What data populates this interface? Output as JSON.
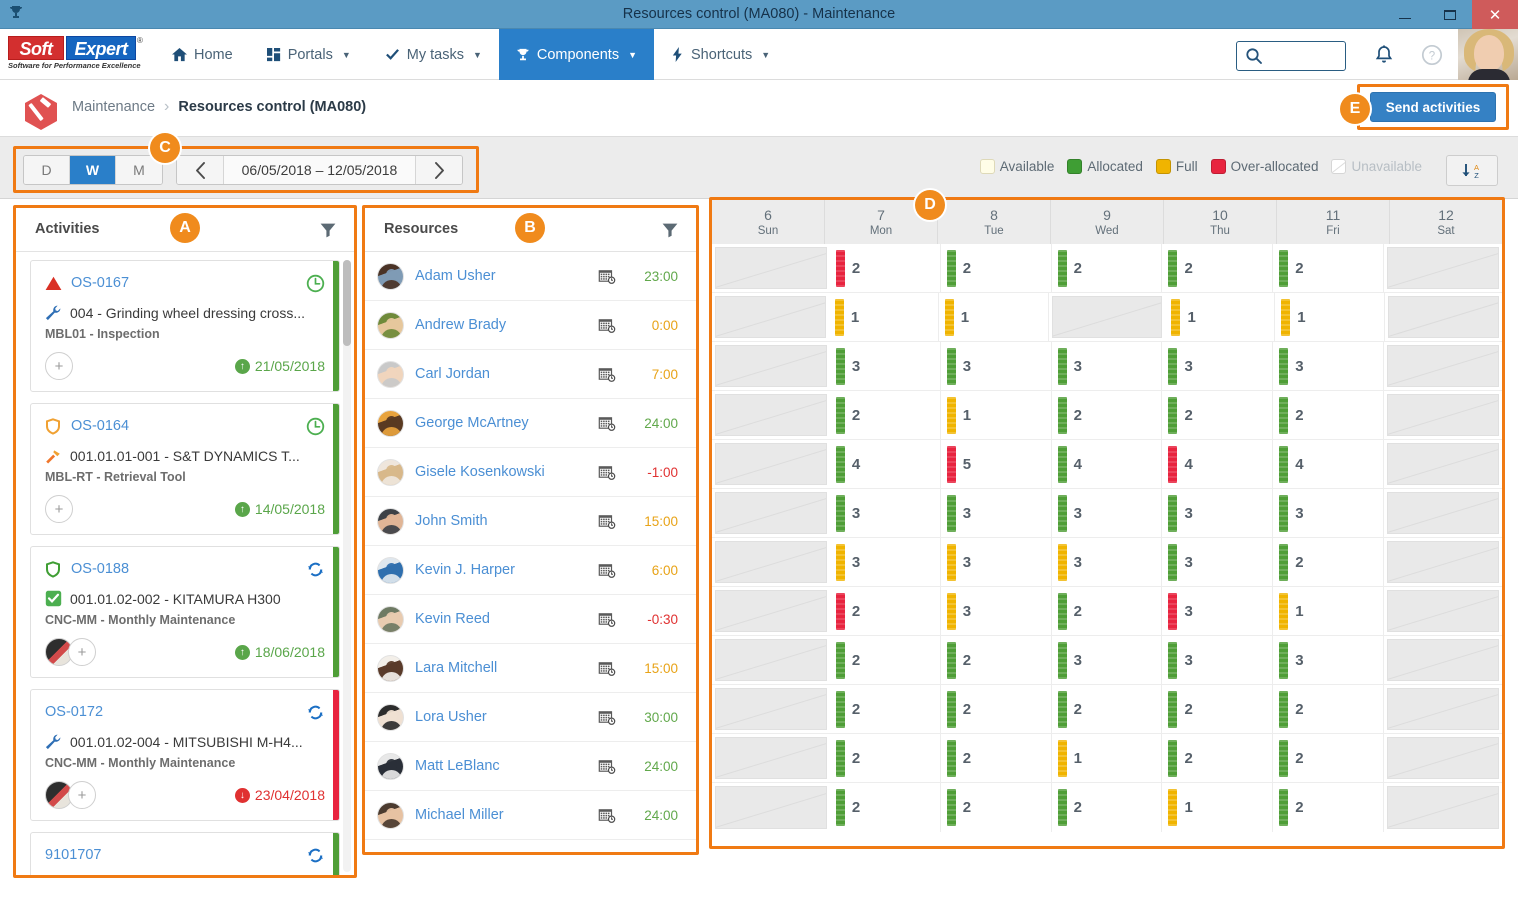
{
  "window": {
    "title": "Resources control (MA080) - Maintenance",
    "app_icon": "trophy-icon",
    "minimize": "–",
    "maximize": "☐",
    "close": "✕"
  },
  "topnav": {
    "logo": {
      "part1": "Soft",
      "part2": "Expert",
      "registered": "®",
      "tagline": "Software for Performance Excellence"
    },
    "items": [
      {
        "label": "Home",
        "icon": "home-icon",
        "caret": false,
        "active": false
      },
      {
        "label": "Portals",
        "icon": "grid-icon",
        "caret": true,
        "active": false
      },
      {
        "label": "My tasks",
        "icon": "check-icon",
        "caret": true,
        "active": false
      },
      {
        "label": "Components",
        "icon": "trophy-icon",
        "caret": true,
        "active": true
      },
      {
        "label": "Shortcuts",
        "icon": "bolt-icon",
        "caret": true,
        "active": false
      }
    ],
    "search": {
      "placeholder": "",
      "value": "",
      "icon": "search-icon"
    },
    "notifications_icon": "bell-icon",
    "help_icon": "question-circle-icon",
    "avatar": "user-avatar"
  },
  "breadcrumb": {
    "module_icon": "maintenance-hammer-icon",
    "parent": "Maintenance",
    "separator": "›",
    "current": "Resources control (MA080)"
  },
  "actions": {
    "send_activities": "Send activities"
  },
  "callouts": {
    "a": "A",
    "b": "B",
    "c": "C",
    "d": "D",
    "e": "E"
  },
  "toolbar": {
    "view_modes": [
      {
        "label": "D",
        "active": false
      },
      {
        "label": "W",
        "active": true
      },
      {
        "label": "M",
        "active": false
      }
    ],
    "prev_icon": "chevron-left-icon",
    "next_icon": "chevron-right-icon",
    "date_range": "06/05/2018 – 12/05/2018",
    "sort_icon": "sort-az-descending-icon",
    "legend": [
      {
        "label": "Available",
        "color": "#fffde7",
        "dim": false
      },
      {
        "label": "Allocated",
        "color": "#3f9e34",
        "dim": false
      },
      {
        "label": "Full",
        "color": "#f0b400",
        "dim": false
      },
      {
        "label": "Over-allocated",
        "color": "#e8243f",
        "dim": false
      },
      {
        "label": "Unavailable",
        "color": "#ffffff",
        "dim": true
      }
    ]
  },
  "activities_panel": {
    "title": "Activities",
    "filter_icon": "funnel-icon",
    "cards": [
      {
        "code": "OS-0167",
        "status_icon": "triangle-warning-icon",
        "status_color": "#d93025",
        "right_icon": "clock-icon",
        "right_icon_color": "#4caf50",
        "asset_icon": "wrench-icon",
        "asset": "004 - Grinding wheel dressing cross...",
        "task": "MBL01 - Inspection",
        "date": "21/05/2018",
        "date_state": "ok",
        "date_arrow": "↑",
        "stripe": "#4f9e37",
        "has_avatar": false,
        "add_label": "+"
      },
      {
        "code": "OS-0164",
        "status_icon": "shield-icon",
        "status_color": "#f0a132",
        "right_icon": "clock-icon",
        "right_icon_color": "#4caf50",
        "asset_icon": "hammer-icon",
        "asset": "001.01.01-001 - S&T DYNAMICS T...",
        "task": "MBL-RT - Retrieval Tool",
        "date": "14/05/2018",
        "date_state": "ok",
        "date_arrow": "↑",
        "stripe": "#4f9e37",
        "has_avatar": false,
        "add_label": "+"
      },
      {
        "code": "OS-0188",
        "status_icon": "shield-icon",
        "status_color": "#3f9e34",
        "right_icon": "sync-icon",
        "right_icon_color": "#1b6fc4",
        "asset_icon": "check-square-icon",
        "asset": "001.01.02-002 - KITAMURA H300",
        "task": "CNC-MM - Monthly Maintenance",
        "date": "18/06/2018",
        "date_state": "ok",
        "date_arrow": "↑",
        "stripe": "#4f9e37",
        "has_avatar": true,
        "add_label": "+"
      },
      {
        "code": "OS-0172",
        "status_icon": "none",
        "status_color": "",
        "right_icon": "sync-icon",
        "right_icon_color": "#1b6fc4",
        "asset_icon": "wrench-icon",
        "asset": "001.01.02-004 - MITSUBISHI M-H4...",
        "task": "CNC-MM - Monthly Maintenance",
        "date": "23/04/2018",
        "date_state": "late",
        "date_arrow": "↓",
        "stripe": "#e8243f",
        "has_avatar": true,
        "add_label": "+"
      },
      {
        "code": "9101707",
        "status_icon": "none",
        "status_color": "",
        "right_icon": "sync-icon",
        "right_icon_color": "#1b6fc4",
        "asset_icon": "none",
        "asset": "",
        "task": "",
        "date": "",
        "date_state": "ok",
        "date_arrow": "",
        "stripe": "#4f9e37",
        "has_avatar": false,
        "add_label": "+"
      }
    ]
  },
  "resources_panel": {
    "title": "Resources",
    "filter_icon": "funnel-icon",
    "calendar_icon": "calendar-clock-icon",
    "rows": [
      {
        "name": "Adam Usher",
        "hours": "23:00",
        "state": "green",
        "avatar_colors": [
          "#4a3326",
          "#7f9bb5"
        ]
      },
      {
        "name": "Andrew Brady",
        "hours": "0:00",
        "state": "amber",
        "avatar_colors": [
          "#6f8a3a",
          "#e6c79c"
        ]
      },
      {
        "name": "Carl Jordan",
        "hours": "7:00",
        "state": "amber",
        "avatar_colors": [
          "#c9c9c9",
          "#f0d5bd"
        ]
      },
      {
        "name": "George McArtney",
        "hours": "24:00",
        "state": "green",
        "avatar_colors": [
          "#e8a33d",
          "#5a3a22"
        ]
      },
      {
        "name": "Gisele Kosenkowski",
        "hours": "-1:00",
        "state": "red",
        "avatar_colors": [
          "#efe6dc",
          "#d8b88a"
        ]
      },
      {
        "name": "John Smith",
        "hours": "15:00",
        "state": "amber",
        "avatar_colors": [
          "#3d4146",
          "#e0b596"
        ]
      },
      {
        "name": "Kevin J. Harper",
        "hours": "6:00",
        "state": "amber",
        "avatar_colors": [
          "#dfe7ee",
          "#2f6fae"
        ]
      },
      {
        "name": "Kevin Reed",
        "hours": "-0:30",
        "state": "red",
        "avatar_colors": [
          "#6e7a63",
          "#e8cbb0"
        ]
      },
      {
        "name": "Lara Mitchell",
        "hours": "15:00",
        "state": "amber",
        "avatar_colors": [
          "#f3efe9",
          "#5a3b2a"
        ]
      },
      {
        "name": "Lora Usher",
        "hours": "30:00",
        "state": "green",
        "avatar_colors": [
          "#2c2c2c",
          "#efe0d2"
        ]
      },
      {
        "name": "Matt LeBlanc",
        "hours": "24:00",
        "state": "green",
        "avatar_colors": [
          "#e8e8e8",
          "#2a2f38"
        ]
      },
      {
        "name": "Michael Miller",
        "hours": "24:00",
        "state": "green",
        "avatar_colors": [
          "#4b3b2f",
          "#e7c2a2"
        ]
      }
    ]
  },
  "chart_data": {
    "type": "heatmap",
    "title": "Resource allocation per day",
    "columns": [
      {
        "day": "6",
        "weekday": "Sun",
        "working": false
      },
      {
        "day": "7",
        "weekday": "Mon",
        "working": true
      },
      {
        "day": "8",
        "weekday": "Tue",
        "working": true
      },
      {
        "day": "9",
        "weekday": "Wed",
        "working": true
      },
      {
        "day": "10",
        "weekday": "Thu",
        "working": true
      },
      {
        "day": "11",
        "weekday": "Fri",
        "working": true
      },
      {
        "day": "12",
        "weekday": "Sat",
        "working": false
      }
    ],
    "legend_position": "top-right",
    "rows": [
      {
        "resource": "Adam Usher",
        "cells": [
          null,
          {
            "v": "2",
            "s": "red"
          },
          {
            "v": "2",
            "s": "green"
          },
          {
            "v": "2",
            "s": "green"
          },
          {
            "v": "2",
            "s": "green"
          },
          {
            "v": "2",
            "s": "green"
          },
          null
        ]
      },
      {
        "resource": "Andrew Brady",
        "cells": [
          null,
          {
            "v": "1",
            "s": "amber"
          },
          {
            "v": "1",
            "s": "amber"
          },
          null,
          {
            "v": "1",
            "s": "amber"
          },
          {
            "v": "1",
            "s": "amber"
          },
          null
        ]
      },
      {
        "resource": "Carl Jordan",
        "cells": [
          null,
          {
            "v": "3",
            "s": "green"
          },
          {
            "v": "3",
            "s": "green"
          },
          {
            "v": "3",
            "s": "green"
          },
          {
            "v": "3",
            "s": "green"
          },
          {
            "v": "3",
            "s": "green"
          },
          null
        ]
      },
      {
        "resource": "George McArtney",
        "cells": [
          null,
          {
            "v": "2",
            "s": "green"
          },
          {
            "v": "1",
            "s": "amber"
          },
          {
            "v": "2",
            "s": "green"
          },
          {
            "v": "2",
            "s": "green"
          },
          {
            "v": "2",
            "s": "green"
          },
          null
        ]
      },
      {
        "resource": "Gisele Kosenkowski",
        "cells": [
          null,
          {
            "v": "4",
            "s": "green"
          },
          {
            "v": "5",
            "s": "red"
          },
          {
            "v": "4",
            "s": "green"
          },
          {
            "v": "4",
            "s": "red"
          },
          {
            "v": "4",
            "s": "green"
          },
          null
        ]
      },
      {
        "resource": "John Smith",
        "cells": [
          null,
          {
            "v": "3",
            "s": "green"
          },
          {
            "v": "3",
            "s": "green"
          },
          {
            "v": "3",
            "s": "green"
          },
          {
            "v": "3",
            "s": "green"
          },
          {
            "v": "3",
            "s": "green"
          },
          null
        ]
      },
      {
        "resource": "Kevin J. Harper",
        "cells": [
          null,
          {
            "v": "3",
            "s": "amber"
          },
          {
            "v": "3",
            "s": "amber"
          },
          {
            "v": "3",
            "s": "amber"
          },
          {
            "v": "3",
            "s": "green"
          },
          {
            "v": "2",
            "s": "green"
          },
          null
        ]
      },
      {
        "resource": "Kevin Reed",
        "cells": [
          null,
          {
            "v": "2",
            "s": "red"
          },
          {
            "v": "3",
            "s": "amber"
          },
          {
            "v": "2",
            "s": "green"
          },
          {
            "v": "3",
            "s": "red"
          },
          {
            "v": "1",
            "s": "amber"
          },
          null
        ]
      },
      {
        "resource": "Lara Mitchell",
        "cells": [
          null,
          {
            "v": "2",
            "s": "green"
          },
          {
            "v": "2",
            "s": "green"
          },
          {
            "v": "3",
            "s": "green"
          },
          {
            "v": "3",
            "s": "green"
          },
          {
            "v": "3",
            "s": "green"
          },
          null
        ]
      },
      {
        "resource": "Lora Usher",
        "cells": [
          null,
          {
            "v": "2",
            "s": "green"
          },
          {
            "v": "2",
            "s": "green"
          },
          {
            "v": "2",
            "s": "green"
          },
          {
            "v": "2",
            "s": "green"
          },
          {
            "v": "2",
            "s": "green"
          },
          null
        ]
      },
      {
        "resource": "Matt LeBlanc",
        "cells": [
          null,
          {
            "v": "2",
            "s": "green"
          },
          {
            "v": "2",
            "s": "green"
          },
          {
            "v": "1",
            "s": "amber"
          },
          {
            "v": "2",
            "s": "green"
          },
          {
            "v": "2",
            "s": "green"
          },
          null
        ]
      },
      {
        "resource": "Michael Miller",
        "cells": [
          null,
          {
            "v": "2",
            "s": "green"
          },
          {
            "v": "2",
            "s": "green"
          },
          {
            "v": "2",
            "s": "green"
          },
          {
            "v": "1",
            "s": "amber"
          },
          {
            "v": "2",
            "s": "green"
          },
          null
        ]
      }
    ]
  }
}
